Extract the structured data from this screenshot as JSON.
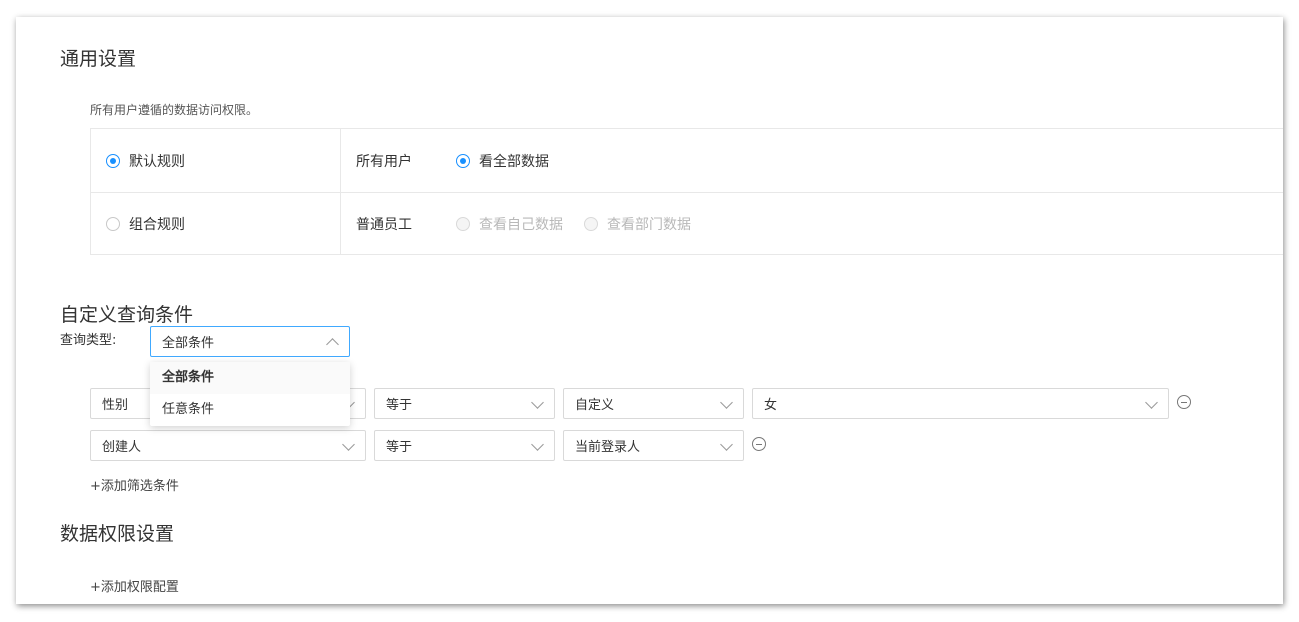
{
  "general": {
    "title": "通用设置",
    "description": "所有用户遵循的数据访问权限。",
    "rules": [
      {
        "label": "默认规则",
        "checked": true
      },
      {
        "label": "组合规则",
        "checked": false
      }
    ],
    "rows": [
      {
        "group": "所有用户",
        "options": [
          {
            "label": "看全部数据",
            "checked": true,
            "disabled": false
          }
        ]
      },
      {
        "group": "普通员工",
        "options": [
          {
            "label": "查看自己数据",
            "checked": false,
            "disabled": true
          },
          {
            "label": "查看部门数据",
            "checked": false,
            "disabled": true
          }
        ]
      }
    ]
  },
  "custom": {
    "title": "自定义查询条件",
    "query_type_label": "查询类型:",
    "query_type_value": "全部条件",
    "query_type_options": [
      "全部条件",
      "任意条件"
    ],
    "conditions": [
      {
        "field": "性别",
        "operator": "等于",
        "value_type": "自定义",
        "value": "女"
      },
      {
        "field": "创建人",
        "operator": "等于",
        "value_type": "当前登录人"
      }
    ],
    "add_filter": "+添加筛选条件"
  },
  "permission": {
    "title": "数据权限设置",
    "add_config": "+添加权限配置"
  },
  "colors": {
    "accent": "#1890ff",
    "border": "#d9d9d9"
  }
}
